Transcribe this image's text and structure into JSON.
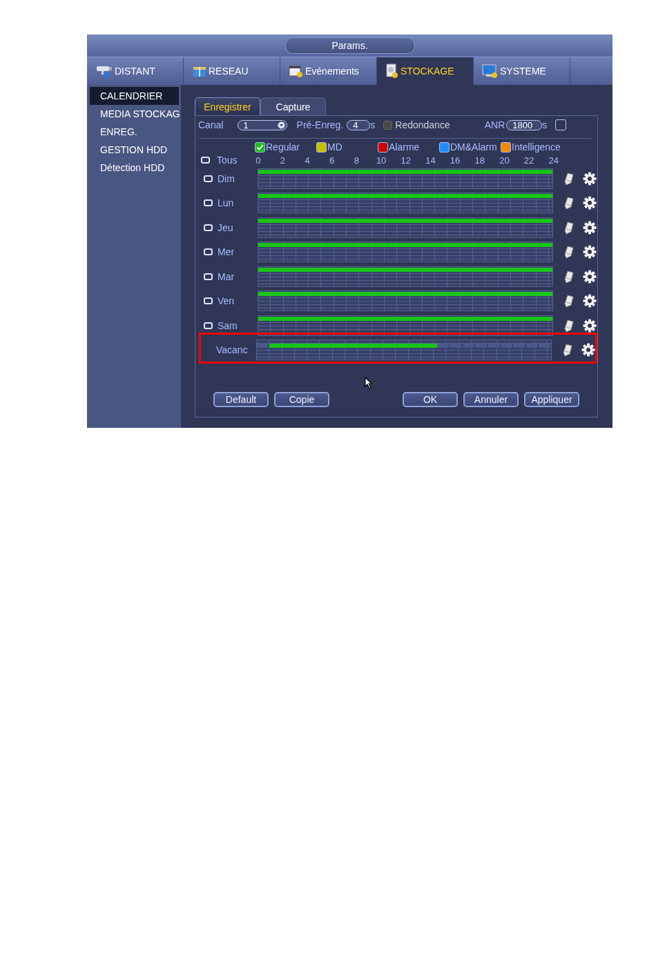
{
  "window": {
    "title": "Params."
  },
  "tabs": [
    {
      "label": "DISTANT",
      "selected": false
    },
    {
      "label": "RESEAU",
      "selected": false
    },
    {
      "label": "Evénements",
      "selected": false
    },
    {
      "label": "STOCKAGE",
      "selected": true
    },
    {
      "label": "SYSTEME",
      "selected": false
    }
  ],
  "sidebar": {
    "items": [
      {
        "label": "CALENDRIER",
        "selected": true
      },
      {
        "label": "MEDIA STOCKAG",
        "selected": false
      },
      {
        "label": "ENREG.",
        "selected": false
      },
      {
        "label": "GESTION HDD",
        "selected": false
      },
      {
        "label": "Détection HDD",
        "selected": false
      }
    ]
  },
  "subtabs": [
    {
      "label": "Enregistrer",
      "selected": true
    },
    {
      "label": "Capture",
      "selected": false
    }
  ],
  "settings": {
    "channel": {
      "label": "Canal",
      "value": "1"
    },
    "pre_record": {
      "label": "Pré-Enreg.",
      "value": "4",
      "unit": "s"
    },
    "redundancy": {
      "label": "Redondance",
      "disabled": true
    },
    "anr": {
      "label": "ANR",
      "value": "1800",
      "unit": "s",
      "checked": false
    }
  },
  "legend": [
    {
      "label": "Regular",
      "color": "#18c018",
      "checked": true
    },
    {
      "label": "MD",
      "color": "#c8c000",
      "checked": false
    },
    {
      "label": "Alarme",
      "color": "#cc0000",
      "checked": false
    },
    {
      "label": "DM&Alarm",
      "color": "#1e8cff",
      "checked": false
    },
    {
      "label": "Intelligence",
      "color": "#f08c00",
      "checked": false
    }
  ],
  "all_label": "Tous",
  "hour_ticks": [
    "0",
    "2",
    "4",
    "6",
    "8",
    "10",
    "12",
    "14",
    "16",
    "18",
    "20",
    "22",
    "24"
  ],
  "days": [
    {
      "label": "Dim",
      "kind": "day",
      "highlighted": false,
      "hours": [
        true,
        true,
        true,
        true,
        true,
        true,
        true,
        true,
        true,
        true,
        true,
        true,
        true,
        true,
        true,
        true,
        true,
        true,
        true,
        true,
        true,
        true,
        true,
        true
      ]
    },
    {
      "label": "Lun",
      "kind": "day",
      "highlighted": false,
      "hours": [
        true,
        true,
        true,
        true,
        true,
        true,
        true,
        true,
        true,
        true,
        true,
        true,
        true,
        true,
        true,
        true,
        true,
        true,
        true,
        true,
        true,
        true,
        true,
        true
      ]
    },
    {
      "label": "Jeu",
      "kind": "day",
      "highlighted": false,
      "hours": [
        true,
        true,
        true,
        true,
        true,
        true,
        true,
        true,
        true,
        true,
        true,
        true,
        true,
        true,
        true,
        true,
        true,
        true,
        true,
        true,
        true,
        true,
        true,
        true
      ]
    },
    {
      "label": "Mer",
      "kind": "day",
      "highlighted": false,
      "hours": [
        true,
        true,
        true,
        true,
        true,
        true,
        true,
        true,
        true,
        true,
        true,
        true,
        true,
        true,
        true,
        true,
        true,
        true,
        true,
        true,
        true,
        true,
        true,
        true
      ]
    },
    {
      "label": "Mar",
      "kind": "day",
      "highlighted": false,
      "hours": [
        true,
        true,
        true,
        true,
        true,
        true,
        true,
        true,
        true,
        true,
        true,
        true,
        true,
        true,
        true,
        true,
        true,
        true,
        true,
        true,
        true,
        true,
        true,
        true
      ]
    },
    {
      "label": "Ven",
      "kind": "day",
      "highlighted": false,
      "hours": [
        true,
        true,
        true,
        true,
        true,
        true,
        true,
        true,
        true,
        true,
        true,
        true,
        true,
        true,
        true,
        true,
        true,
        true,
        true,
        true,
        true,
        true,
        true,
        true
      ]
    },
    {
      "label": "Sam",
      "kind": "day",
      "highlighted": false,
      "hours": [
        true,
        true,
        true,
        true,
        true,
        true,
        true,
        true,
        true,
        true,
        true,
        true,
        true,
        true,
        true,
        true,
        true,
        true,
        true,
        true,
        true,
        true,
        true,
        true
      ]
    },
    {
      "label": "Vacanc",
      "kind": "holiday",
      "highlighted": true,
      "hours": [
        false,
        true,
        true,
        true,
        true,
        true,
        true,
        true,
        true,
        true,
        true,
        true,
        true,
        true,
        true,
        false,
        false,
        false,
        false,
        false,
        false,
        false,
        false,
        false
      ]
    }
  ],
  "buttons": {
    "left": [
      "Default",
      "Copie"
    ],
    "right": [
      "OK",
      "Annuler",
      "Appliquer"
    ]
  }
}
